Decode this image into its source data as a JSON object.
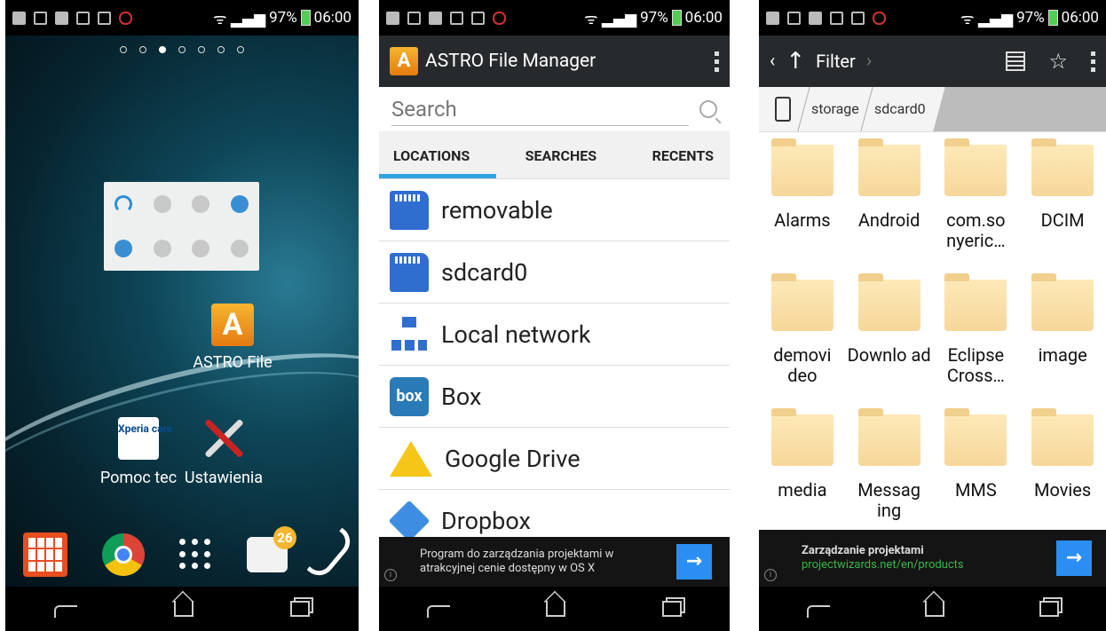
{
  "status": {
    "battery": "97%",
    "time": "06:00"
  },
  "home": {
    "astro_label": "ASTRO File",
    "pomoc_label": "Pomoc tec",
    "ustawienia_label": "Ustawienia",
    "xperia_icon_text": "Xperia care",
    "dock_badge": "26"
  },
  "astro": {
    "title": "ASTRO File Manager",
    "search_placeholder": "Search",
    "tabs": [
      "LOCATIONS",
      "SEARCHES",
      "RECENTS"
    ],
    "locations": [
      "removable",
      "sdcard0",
      "Local network",
      "Box",
      "Google Drive",
      "Dropbox"
    ],
    "box_icon_text": "box",
    "ad": {
      "line1": "Program do zarządzania projektami w",
      "line2": "atrakcyjnej cenie dostępny w OS X"
    }
  },
  "browser": {
    "filter_label": "Filter",
    "crumbs": [
      "storage",
      "sdcard0"
    ],
    "folders": [
      "Alarms",
      "Android",
      "com.so nyeric…",
      "DCIM",
      "demovi deo",
      "Downlo ad",
      "Eclipse Cross…",
      "image",
      "media",
      "Messag ing",
      "MMS",
      "Movies"
    ],
    "ad": {
      "title": "Zarządzanie projektami",
      "link": "projectwizards.net/en/products"
    }
  }
}
